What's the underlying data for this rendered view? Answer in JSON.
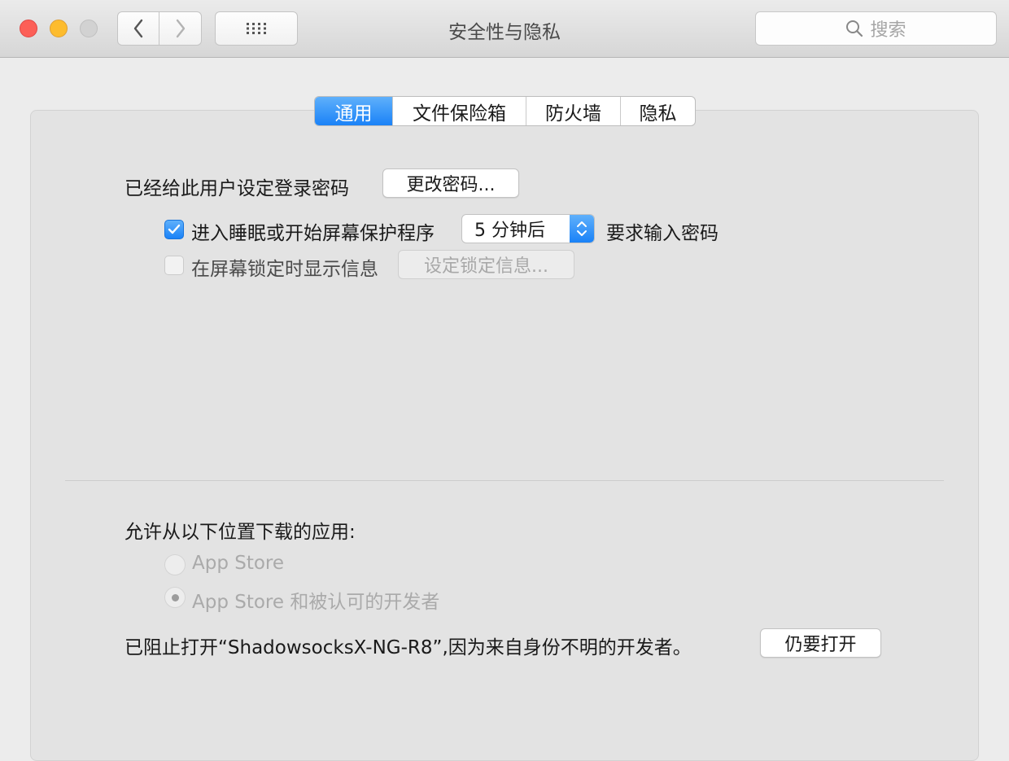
{
  "window": {
    "title": "安全性与隐私"
  },
  "search": {
    "placeholder": "搜索"
  },
  "tabs": [
    {
      "label": "通用",
      "active": true
    },
    {
      "label": "文件保险箱"
    },
    {
      "label": "防火墙"
    },
    {
      "label": "隐私"
    }
  ],
  "general": {
    "password_set_label": "已经给此用户设定登录密码",
    "change_password_button": "更改密码...",
    "require_password_checkbox": {
      "label": "进入睡眠或开始屏幕保护程序",
      "checked": true
    },
    "require_password_delay": "5 分钟后",
    "require_password_suffix": "要求输入密码",
    "lock_message_checkbox": {
      "label": "在屏幕锁定时显示信息",
      "checked": false
    },
    "set_lock_message_button": "设定锁定信息..."
  },
  "downloads": {
    "heading": "允许从以下位置下载的应用:",
    "options": [
      {
        "label": "App Store",
        "selected": false
      },
      {
        "label": "App Store 和被认可的开发者",
        "selected": true
      }
    ],
    "blocked_message": "已阻止打开“ShadowsocksX-NG-R8”,因为来自身份不明的开发者。",
    "open_anyway_button": "仍要打开"
  },
  "colors": {
    "accent": "#1a82f7",
    "close": "#fc5f57",
    "minimize": "#fdbc2e"
  }
}
